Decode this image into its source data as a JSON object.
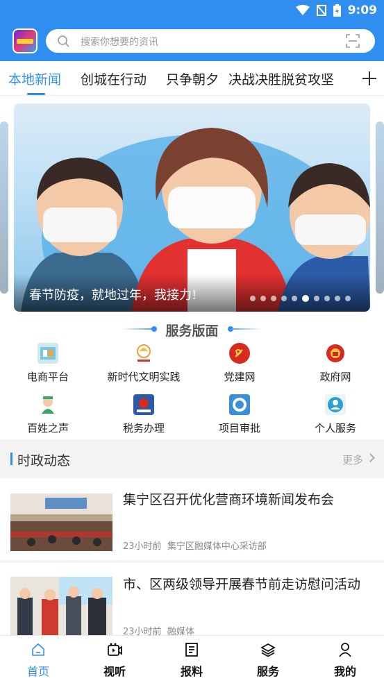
{
  "status": {
    "time": "9:09"
  },
  "search": {
    "placeholder": "搜索你想要的资讯"
  },
  "tabs": [
    {
      "label": "本地新闻",
      "active": true
    },
    {
      "label": "创城在行动",
      "active": false
    },
    {
      "label": "只争朝夕",
      "active": false
    },
    {
      "label": "决战决胜脱贫攻坚",
      "active": false
    }
  ],
  "banner": {
    "caption": "春节防疫，就地过年，我接力!",
    "slide_count": 10,
    "active_slide": 5
  },
  "services": {
    "title": "服务版面",
    "items": [
      {
        "label": "电商平台",
        "icon": "ecommerce-icon",
        "color": "#5fb3d6"
      },
      {
        "label": "新时代文明实践",
        "icon": "civilization-icon",
        "color": "#e8a23a"
      },
      {
        "label": "党建网",
        "icon": "party-icon",
        "color": "#d72a20"
      },
      {
        "label": "政府网",
        "icon": "government-icon",
        "color": "#d72a20"
      },
      {
        "label": "百姓之声",
        "icon": "people-voice-icon",
        "color": "#3aa66b"
      },
      {
        "label": "税务办理",
        "icon": "tax-icon",
        "color": "#2c5aa6"
      },
      {
        "label": "项目审批",
        "icon": "approval-icon",
        "color": "#3a8fd6"
      },
      {
        "label": "个人服务",
        "icon": "personal-service-icon",
        "color": "#2f9ecf"
      }
    ]
  },
  "section": {
    "title": "时政动态",
    "more": "更多"
  },
  "news": [
    {
      "title": "集宁区召开优化营商环境新闻发布会",
      "time": "23小时前",
      "source": "集宁区融媒体中心采访部"
    },
    {
      "title": "市、区两级领导开展春节前走访慰问活动",
      "time": "23小时前",
      "source": "融媒体"
    }
  ],
  "bottom_nav": [
    {
      "label": "首页",
      "icon": "home-icon",
      "active": true
    },
    {
      "label": "视听",
      "icon": "video-icon",
      "active": false
    },
    {
      "label": "报料",
      "icon": "report-icon",
      "active": false
    },
    {
      "label": "服务",
      "icon": "layers-icon",
      "active": false
    },
    {
      "label": "我的",
      "icon": "user-icon",
      "active": false
    }
  ],
  "colors": {
    "brand": "#2f8ef0"
  }
}
